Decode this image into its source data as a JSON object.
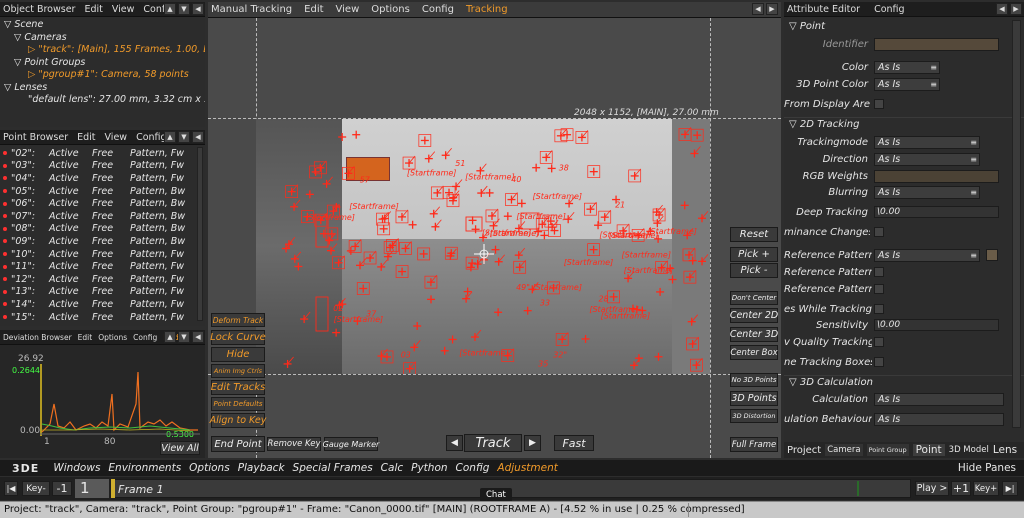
{
  "object_browser": {
    "menu": [
      "Object Browser",
      "Edit",
      "View",
      "Config"
    ],
    "scene": "Scene",
    "cameras": "Cameras",
    "camera_item": "\"track\": [Main], 155 Frames, 1.00, Len",
    "point_groups": "Point Groups",
    "pgroup_item": "\"pgroup#1\": Camera, 58 points",
    "lenses": "Lenses",
    "lens_item": "\"default lens\": 27.00 mm, 3.32 cm x 1.87"
  },
  "point_browser": {
    "menu": [
      "Point Browser",
      "Edit",
      "View",
      "Config"
    ],
    "rows": [
      {
        "n": "\"02\":",
        "s": "Active",
        "m": "Free",
        "t": "Pattern, Fw"
      },
      {
        "n": "\"03\":",
        "s": "Active",
        "m": "Free",
        "t": "Pattern, Fw"
      },
      {
        "n": "\"04\":",
        "s": "Active",
        "m": "Free",
        "t": "Pattern, Fw"
      },
      {
        "n": "\"05\":",
        "s": "Active",
        "m": "Free",
        "t": "Pattern, Bw"
      },
      {
        "n": "\"06\":",
        "s": "Active",
        "m": "Free",
        "t": "Pattern, Bw"
      },
      {
        "n": "\"07\":",
        "s": "Active",
        "m": "Free",
        "t": "Pattern, Bw"
      },
      {
        "n": "\"08\":",
        "s": "Active",
        "m": "Free",
        "t": "Pattern, Bw"
      },
      {
        "n": "\"09\":",
        "s": "Active",
        "m": "Free",
        "t": "Pattern, Bw"
      },
      {
        "n": "\"10\":",
        "s": "Active",
        "m": "Free",
        "t": "Pattern, Fw"
      },
      {
        "n": "\"11\":",
        "s": "Active",
        "m": "Free",
        "t": "Pattern, Fw"
      },
      {
        "n": "\"12\":",
        "s": "Active",
        "m": "Free",
        "t": "Pattern, Fw"
      },
      {
        "n": "\"13\":",
        "s": "Active",
        "m": "Free",
        "t": "Pattern, Fw"
      },
      {
        "n": "\"14\":",
        "s": "Active",
        "m": "Free",
        "t": "Pattern, Fw"
      },
      {
        "n": "\"15\":",
        "s": "Active",
        "m": "Free",
        "t": "Pattern, Fw"
      }
    ]
  },
  "deviation_browser": {
    "menu": [
      "Deviation Browser",
      "Edit",
      "Options",
      "Config"
    ],
    "find": "Find",
    "y_max": "26.92",
    "y_cur": "0.2644",
    "y_min": "0.00",
    "x_left": "1",
    "x_mid": "80",
    "right_val": "0.5300",
    "view_all": "View All"
  },
  "viewport": {
    "menu": [
      "Manual Tracking",
      "Edit",
      "View",
      "Options",
      "Config"
    ],
    "active_menu": "Tracking",
    "info": "2048 x 1152, [MAIN], 27.00 mm",
    "marker_labels": [
      "51",
      "49\" [Startframe]",
      "[Startframe]",
      "57",
      "[Startframe]",
      "[Startframe]",
      "28",
      "02",
      "03",
      "35",
      "32\"",
      "37",
      "[Startframe]",
      "[Startframe]",
      "[Startframe]",
      "[Startframe]",
      "[Startframe]",
      "33",
      "[Startframe]",
      "38",
      "[Startframe]",
      "[Startframe]",
      "40",
      "21",
      "[Startframe]",
      "[Startframe]",
      "[Startframe]",
      "[Startframe]",
      "[Startframe]",
      "[Startframe]",
      "[Startframe]"
    ]
  },
  "left_tools": {
    "deform_track": "Deform Track",
    "lock_curve": "Lock Curve",
    "hide": "Hide",
    "anim_img_ctrls": "Anim Img Ctrls",
    "edit_tracks": "Edit Tracks",
    "point_defaults": "Point Defaults",
    "align_to_key": "Align to Key",
    "end_point": "End Point",
    "remove_key": "Remove Key",
    "gauge_marker": "Gauge Marker"
  },
  "right_tools": {
    "reset": "Reset",
    "pick_plus": "Pick +",
    "pick_minus": "Pick -",
    "dont_center": "Don't Center",
    "center_2d": "Center 2D",
    "center_3d": "Center 3D",
    "center_box": "Center Box",
    "no_3d_points": "No 3D Points",
    "points_3d": "3D Points",
    "distortion_3d": "3D Distortion",
    "full_frame": "Full Frame"
  },
  "track_controls": {
    "prev": "◀",
    "track": "Track",
    "next": "▶",
    "fast": "Fast"
  },
  "attribute_editor": {
    "menu": [
      "Attribute Editor",
      "Config"
    ],
    "point_section": "Point",
    "identifier": "Identifier",
    "color": "Color",
    "color_val": "As Is",
    "point3d_color": "3D Point Color",
    "point3d_color_val": "As Is",
    "from_display_area": "From Display Area",
    "tracking_section": "2D Tracking",
    "trackingmode": "Trackingmode",
    "trackingmode_val": "As Is",
    "direction": "Direction",
    "direction_val": "As Is",
    "rgb_weights": "RGB Weights",
    "blurring": "Blurring",
    "blurring_val": "As Is",
    "deep_tracking": "Deep Tracking",
    "deep_tracking_val": "0.00",
    "luminance_changes": "minance Changes",
    "reference_pattern1": "Reference Pattern",
    "reference_pattern1_val": "As Is",
    "reference_pattern2": "Reference Pattern",
    "reference_pattern3": "Reference Pattern",
    "while_tracking": "es While Tracking",
    "sensitivity": "Sensitivity",
    "sensitivity_val": "0.00",
    "quality_tracking": "v Quality Tracking",
    "tracking_boxes": "ne Tracking Boxes",
    "calc_section": "3D Calculation",
    "calculation": "Calculation",
    "calculation_val": "As Is",
    "behaviour": "ulation Behaviour",
    "behaviour_val": "As Is",
    "tabs": [
      "Project",
      "Camera",
      "Point Group",
      "Point",
      "3D Model",
      "Lens"
    ]
  },
  "menubar": {
    "logo": "3DE",
    "items": [
      "Windows",
      "Environments",
      "Options",
      "Playback",
      "Special Frames",
      "Calc",
      "Python",
      "Config"
    ],
    "active": "Adjustment",
    "hide_panes": "Hide Panes"
  },
  "timeline": {
    "key_minus": "Key-",
    "minus1": "-1",
    "frame_num": "1",
    "frame_label": "Frame 1",
    "chat": "Chat",
    "play": "Play >",
    "plus1": "+1",
    "key_plus": "Key+"
  },
  "status": {
    "text": "Project: \"track\", Camera: \"track\", Point Group: \"pgroup#1\" - Frame: \"Canon_0000.tif\" [MAIN] (ROOTFRAME A) - [4.52 % in use | 0.25 % compressed]"
  },
  "colors": {
    "accent": "#f09a2a",
    "marker": "#ff2a1a",
    "bg": "#2c2c2c"
  }
}
